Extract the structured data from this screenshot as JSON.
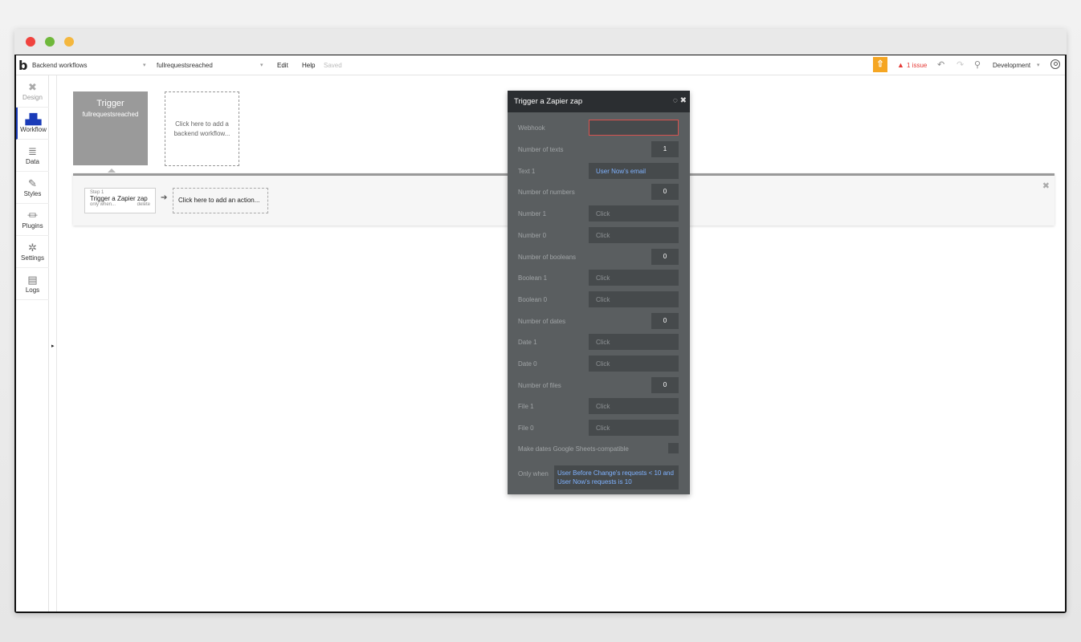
{
  "topbar": {
    "logo": "b",
    "page_select": "Backend workflows",
    "workflow_select": "fullrequestsreached",
    "edit": "Edit",
    "help": "Help",
    "saved": "Saved",
    "issue_count": "1 issue",
    "env": "Development"
  },
  "sidebar": {
    "items": [
      {
        "label": "Design",
        "icon": "design-icon"
      },
      {
        "label": "Workflow",
        "icon": "workflow-icon"
      },
      {
        "label": "Data",
        "icon": "data-icon"
      },
      {
        "label": "Styles",
        "icon": "styles-icon"
      },
      {
        "label": "Plugins",
        "icon": "plugins-icon"
      },
      {
        "label": "Settings",
        "icon": "settings-icon"
      },
      {
        "label": "Logs",
        "icon": "logs-icon"
      }
    ]
  },
  "canvas": {
    "trigger_title": "Trigger",
    "trigger_name": "fullrequestsreached",
    "add_workflow": "Click here to add a backend workflow...",
    "step_label": "Step 1",
    "step_name": "Trigger a Zapier zap",
    "step_only_when": "only when...",
    "step_delete": "delete",
    "add_action": "Click here to add an action..."
  },
  "panel": {
    "title": "Trigger a Zapier zap",
    "webhook_label": "Webhook",
    "rows": [
      {
        "label": "Number of texts",
        "value": "1",
        "kind": "num"
      },
      {
        "label": "Text 1",
        "value": "User Now's email",
        "kind": "link"
      },
      {
        "label": "Number of numbers",
        "value": "0",
        "kind": "num"
      },
      {
        "label": "Number 1",
        "value": "Click",
        "kind": "box"
      },
      {
        "label": "Number 0",
        "value": "Click",
        "kind": "box"
      },
      {
        "label": "Number of booleans",
        "value": "0",
        "kind": "num"
      },
      {
        "label": "Boolean 1",
        "value": "Click",
        "kind": "box"
      },
      {
        "label": "Boolean 0",
        "value": "Click",
        "kind": "box"
      },
      {
        "label": "Number of dates",
        "value": "0",
        "kind": "num"
      },
      {
        "label": "Date 1",
        "value": "Click",
        "kind": "box"
      },
      {
        "label": "Date 0",
        "value": "Click",
        "kind": "box"
      },
      {
        "label": "Number of files",
        "value": "0",
        "kind": "num"
      },
      {
        "label": "File 1",
        "value": "Click",
        "kind": "box"
      },
      {
        "label": "File 0",
        "value": "Click",
        "kind": "box"
      }
    ],
    "sheets_label": "Make dates Google Sheets-compatible",
    "only_when_label": "Only when",
    "only_when_value": "User Before Change's requests < 10 and User Now's requests is 10"
  },
  "colors": {
    "accent": "#1a3bb8",
    "issue": "#e53935",
    "gift": "#f5a623",
    "panel_bg": "#5a5e60",
    "panel_head": "#2b2e31"
  }
}
